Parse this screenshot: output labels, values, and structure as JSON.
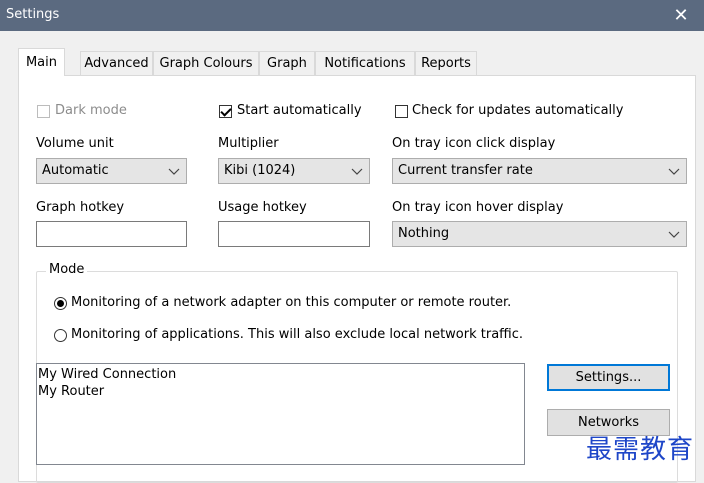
{
  "window": {
    "title": "Settings",
    "close_glyph": "✕"
  },
  "tabs": [
    {
      "label": "Main",
      "active": true
    },
    {
      "label": "Advanced"
    },
    {
      "label": "Graph Colours"
    },
    {
      "label": "Graph"
    },
    {
      "label": "Notifications"
    },
    {
      "label": "Reports"
    }
  ],
  "checkboxes": {
    "dark_mode": {
      "label": "Dark mode",
      "checked": false,
      "enabled": false
    },
    "start_automatically": {
      "label": "Start automatically",
      "checked": true
    },
    "check_updates": {
      "label": "Check for updates automatically",
      "checked": false
    }
  },
  "fields": {
    "volume_unit": {
      "label": "Volume unit",
      "value": "Automatic"
    },
    "multiplier": {
      "label": "Multiplier",
      "value": "Kibi (1024)"
    },
    "tray_click": {
      "label": "On tray icon click display",
      "value": "Current transfer rate"
    },
    "graph_hotkey": {
      "label": "Graph hotkey",
      "value": ""
    },
    "usage_hotkey": {
      "label": "Usage hotkey",
      "value": ""
    },
    "tray_hover": {
      "label": "On tray icon hover display",
      "value": "Nothing"
    }
  },
  "mode": {
    "title": "Mode",
    "option_adapter": "Monitoring of a network adapter on this computer or remote router.",
    "option_apps": "Monitoring of applications. This will also exclude local network traffic.",
    "selected": "adapter",
    "connections": [
      "My Wired Connection",
      "My Router"
    ],
    "settings_button": "Settings...",
    "networks_button": "Networks"
  },
  "watermark": "最需教育",
  "colors": {
    "titlebar": "#5b6a80",
    "focus_border": "#0078d7",
    "watermark": "#1e46c8"
  }
}
